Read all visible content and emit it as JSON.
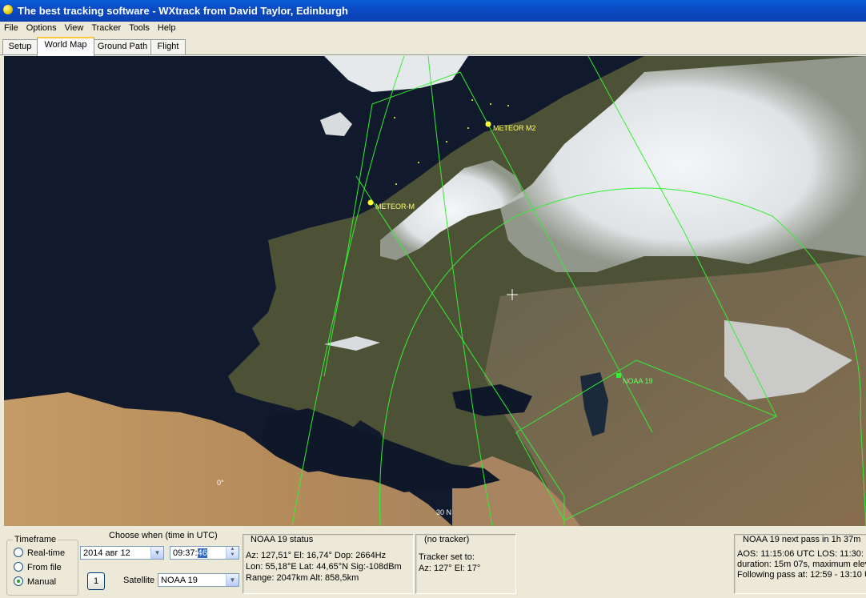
{
  "window": {
    "title": "The best tracking software - WXtrack from David Taylor, Edinburgh"
  },
  "menu": {
    "items": [
      "File",
      "Options",
      "View",
      "Tracker",
      "Tools",
      "Help"
    ]
  },
  "tabs": [
    "Setup",
    "World Map",
    "Ground Path",
    "Flight"
  ],
  "map": {
    "satellites": [
      {
        "name": "METEOR M2"
      },
      {
        "name": "METEOR-M"
      },
      {
        "name": "NOAA 19"
      }
    ],
    "grid_labels": {
      "zero": "0°",
      "lat30": "30 N"
    }
  },
  "timeframe": {
    "title": "Timeframe",
    "options": [
      {
        "label": "Real-time",
        "selected": false
      },
      {
        "label": "From file",
        "selected": false
      },
      {
        "label": "Manual",
        "selected": true
      }
    ]
  },
  "when": {
    "title": "Choose when (time in UTC)",
    "date_value": "2014 авг 12",
    "time_value_hm": "09:37:",
    "time_value_sel": "46",
    "step_button": "1",
    "satellite_label": "Satellite",
    "satellite_value": "NOAA 19"
  },
  "status": {
    "title": "NOAA 19 status",
    "line1": "Az: 127,51°  El: 16,74°  Dop: 2664Hz",
    "line2": "Lon: 55,18°E  Lat: 44,65°N  Sig:-108dBm",
    "line3": "Range: 2047km  Alt: 858,5km"
  },
  "tracker": {
    "title": "(no tracker)",
    "line1": "Tracker set to:",
    "line2": "Az: 127°  El: 17°"
  },
  "next_pass": {
    "title": "NOAA 19 next pass in 1h 37m",
    "line1": "AOS: 11:15:06 UTC  LOS: 11:30:",
    "line2": "duration: 15m 07s,  maximum elev",
    "line3": "Following pass at: 12:59 - 13:10 U"
  },
  "colors": {
    "orbit": "#33ee33",
    "satellite": "#ffff33",
    "titlebar": "#0b4bc4"
  }
}
